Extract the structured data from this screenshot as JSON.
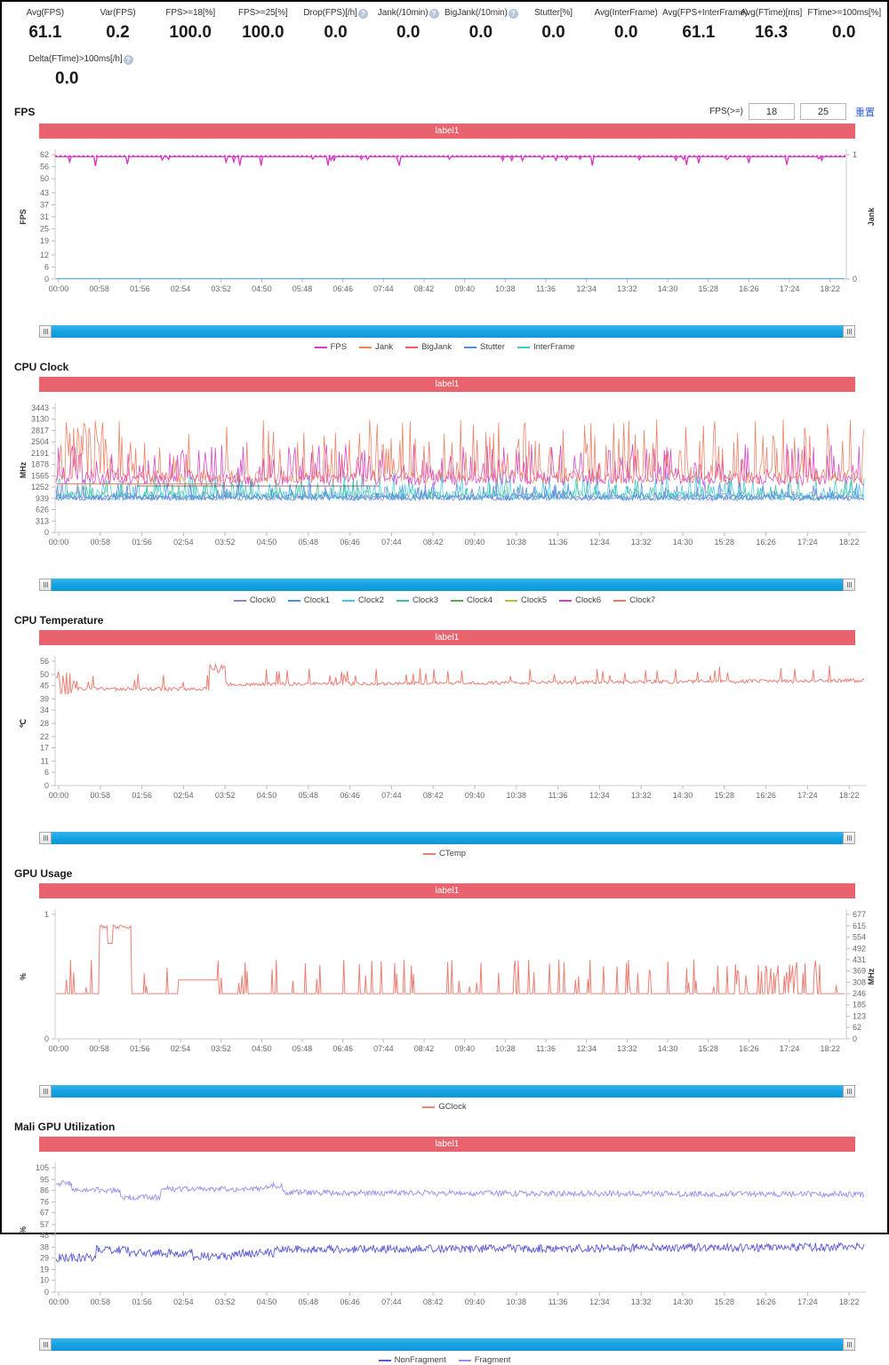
{
  "metrics": {
    "row1": [
      {
        "label": "Avg(FPS)",
        "value": "61.1",
        "help": false
      },
      {
        "label": "Var(FPS)",
        "value": "0.2",
        "help": false
      },
      {
        "label": "FPS>=18[%]",
        "value": "100.0",
        "help": false
      },
      {
        "label": "FPS>=25[%]",
        "value": "100.0",
        "help": false
      },
      {
        "label": "Drop(FPS)[/h]",
        "value": "0.0",
        "help": true
      },
      {
        "label": "Jank(/10min)",
        "value": "0.0",
        "help": true
      },
      {
        "label": "BigJank(/10min)",
        "value": "0.0",
        "help": true
      },
      {
        "label": "Stutter[%]",
        "value": "0.0",
        "help": false
      },
      {
        "label": "Avg(InterFrame)",
        "value": "0.0",
        "help": false
      },
      {
        "label": "Avg(FPS+InterFrame)",
        "value": "61.1",
        "help": false
      },
      {
        "label": "Avg(FTime)[ms]",
        "value": "16.3",
        "help": false
      },
      {
        "label": "FTime>=100ms[%]",
        "value": "0.0",
        "help": false
      }
    ],
    "row2": [
      {
        "label": "Delta(FTime)>100ms[/h]",
        "value": "0.0",
        "help": true
      }
    ]
  },
  "colors": {
    "banner": "#e9636e",
    "scrollbar": "#29ABE2",
    "reset_link": "#2b5fd9",
    "fps": "#d63bc4",
    "jank": "#f4804a",
    "bigjank": "#e9655c",
    "stutter": "#4a90e2",
    "interframe": "#3fc8e0",
    "ctemp": "#ea8176",
    "gclock": "#ea8176",
    "nonfragment": "#5b5bd6",
    "fragment": "#9f8ef0",
    "clock0": "#8a7fe0",
    "clock1": "#4a90e2",
    "clock2": "#3fc8e0",
    "clock3": "#3fbfa0",
    "clock4": "#4caf50",
    "clock5": "#a3c93a",
    "clock6": "#d63bc4",
    "clock7": "#ea7a5c"
  },
  "time_ticks": [
    "00:00",
    "00:58",
    "01:56",
    "02:54",
    "03:52",
    "04:50",
    "05:48",
    "06:46",
    "07:44",
    "08:42",
    "09:40",
    "10:38",
    "11:36",
    "12:34",
    "13:32",
    "14:30",
    "15:28",
    "16:26",
    "17:24",
    "18:22"
  ],
  "banner_label": "label1",
  "scrollbar": {
    "name": "range-scrollbar"
  },
  "sections": [
    {
      "id": "fps",
      "title": "FPS",
      "controls": {
        "label": "FPS(>=)",
        "input1": "18",
        "input2": "25",
        "reset": "重置"
      },
      "legend": [
        {
          "name": "FPS",
          "color": "#d63bc4",
          "marker": "square"
        },
        {
          "name": "Jank",
          "color": "#f4804a",
          "marker": "square"
        },
        {
          "name": "BigJank",
          "color": "#e9655c",
          "marker": "line"
        },
        {
          "name": "Stutter",
          "color": "#4a90e2",
          "marker": "line"
        },
        {
          "name": "InterFrame",
          "color": "#3fc8e0",
          "marker": "line"
        }
      ],
      "chart_data": {
        "type": "line",
        "title": "FPS",
        "xlabel": "",
        "ylabel": "FPS",
        "y2label": "Jank",
        "ylim": [
          0,
          62
        ],
        "y2lim": [
          0,
          1
        ],
        "yticks": [
          0,
          6,
          12,
          19,
          25,
          31,
          37,
          43,
          50,
          56,
          62
        ],
        "y2ticks": [
          0,
          1
        ],
        "grid": false,
        "legend_position": "bottom",
        "series": [
          {
            "name": "FPS",
            "color": "#d63bc4",
            "mean": 61.1,
            "min": 56,
            "max": 62,
            "description": "Near-flat magenta line with square markers at ~60-61 fps, with sporadic downward dips to 56-58"
          },
          {
            "name": "Jank",
            "color": "#f4804a",
            "values": "all zero"
          },
          {
            "name": "BigJank",
            "color": "#e9655c",
            "values": "all zero"
          },
          {
            "name": "Stutter",
            "color": "#4a90e2",
            "values": "all zero"
          },
          {
            "name": "InterFrame",
            "color": "#3fc8e0",
            "values": "all zero"
          }
        ]
      }
    },
    {
      "id": "cpu-clock",
      "title": "CPU Clock",
      "legend": [
        {
          "name": "Clock0",
          "color": "#8a7fe0",
          "marker": "line"
        },
        {
          "name": "Clock1",
          "color": "#4a90e2",
          "marker": "line"
        },
        {
          "name": "Clock2",
          "color": "#3fc8e0",
          "marker": "line"
        },
        {
          "name": "Clock3",
          "color": "#3fbfa0",
          "marker": "line"
        },
        {
          "name": "Clock4",
          "color": "#4caf50",
          "marker": "line"
        },
        {
          "name": "Clock5",
          "color": "#a3c93a",
          "marker": "line"
        },
        {
          "name": "Clock6",
          "color": "#d63bc4",
          "marker": "line"
        },
        {
          "name": "Clock7",
          "color": "#ea7a5c",
          "marker": "line"
        }
      ],
      "chart_data": {
        "type": "line",
        "title": "CPU Clock",
        "ylabel": "MHz",
        "ylim": [
          0,
          3443
        ],
        "yticks": [
          0,
          313,
          626,
          939,
          1252,
          1565,
          1878,
          2191,
          2504,
          2817,
          3130,
          3443
        ],
        "grid": false,
        "legend_position": "bottom",
        "series": [
          {
            "name": "Clock7",
            "color": "#ea7a5c",
            "typical_range": [
              1252,
              3130
            ],
            "description": "Big core, highly spiky, frequent spikes to 2504-3130"
          },
          {
            "name": "Clock6",
            "color": "#d63bc4",
            "typical_range": [
              1252,
              2504
            ],
            "description": "Mid core oscillating 1252-2300"
          },
          {
            "name": "Clock2",
            "color": "#3fc8e0",
            "typical_range": [
              800,
              1878
            ],
            "description": "Little core, rapid oscillation 800-1600"
          },
          {
            "name": "Clock3",
            "color": "#3fbfa0",
            "typical_range": [
              800,
              1565
            ]
          },
          {
            "name": "Clock0",
            "color": "#8a7fe0",
            "typical_range": [
              800,
              1565
            ]
          },
          {
            "name": "Clock1",
            "color": "#4a90e2",
            "typical_range": [
              800,
              1565
            ]
          },
          {
            "name": "Clock4",
            "color": "#4caf50",
            "typical_range": [
              800,
              1565
            ]
          },
          {
            "name": "Clock5",
            "color": "#a3c93a",
            "typical_range": [
              800,
              1565
            ]
          }
        ]
      }
    },
    {
      "id": "cpu-temperature",
      "title": "CPU Temperature",
      "legend": [
        {
          "name": "CTemp",
          "color": "#ea8176",
          "marker": "line"
        }
      ],
      "chart_data": {
        "type": "line",
        "title": "CPU Temperature",
        "ylabel": "℃",
        "ylim": [
          0,
          56
        ],
        "yticks": [
          0,
          6,
          11,
          17,
          22,
          28,
          34,
          39,
          45,
          50,
          56
        ],
        "grid": false,
        "legend_position": "bottom",
        "series": [
          {
            "name": "CTemp",
            "color": "#ea8176",
            "mean": 45,
            "min": 40,
            "max": 56,
            "description": "Starts ~42, spike to 52 near 00:20, settles ~43-45, rises after 03:40 to ~46-48 with frequent spikes to 50-54"
          }
        ]
      }
    },
    {
      "id": "gpu-usage",
      "title": "GPU Usage",
      "legend": [
        {
          "name": "GClock",
          "color": "#ea8176",
          "marker": "line"
        }
      ],
      "chart_data": {
        "type": "line",
        "title": "GPU Usage",
        "ylabel": "%",
        "y2label": "MHz",
        "ylim": [
          0,
          1
        ],
        "yticks": [
          0,
          1
        ],
        "y2lim": [
          0,
          677
        ],
        "y2ticks": [
          0,
          62,
          123,
          185,
          246,
          308,
          369,
          431,
          492,
          554,
          615,
          677
        ],
        "grid": false,
        "legend_position": "bottom",
        "series": [
          {
            "name": "GClock",
            "color": "#ea8176",
            "baseline_mhz": 246,
            "max_mhz": 615,
            "description": "Mostly flat at ~246 MHz baseline with a large burst to ~600 MHz around 00:58 and scattered spikes to 300-430 MHz throughout"
          }
        ]
      }
    },
    {
      "id": "mali-gpu-utilization",
      "title": "Mali GPU Utilization",
      "legend": [
        {
          "name": "NonFragment",
          "color": "#5b5bd6",
          "marker": "line"
        },
        {
          "name": "Fragment",
          "color": "#9f8ef0",
          "marker": "line"
        }
      ],
      "chart_data": {
        "type": "line",
        "title": "Mali GPU Utilization",
        "ylabel": "%",
        "ylim": [
          0,
          105
        ],
        "yticks": [
          0,
          10,
          19,
          29,
          38,
          48,
          57,
          67,
          76,
          86,
          95,
          105
        ],
        "grid": false,
        "legend_position": "bottom",
        "series": [
          {
            "name": "Fragment",
            "color": "#9f8ef0",
            "mean": 85,
            "min": 76,
            "max": 95,
            "description": "Upper light-purple trace, starts ~92, settles 83-88 with noise"
          },
          {
            "name": "NonFragment",
            "color": "#5b5bd6",
            "mean": 34,
            "min": 22,
            "max": 48,
            "description": "Lower blue trace, starts ~29, noisy band 29-42 rising slightly over time"
          }
        ]
      }
    }
  ]
}
